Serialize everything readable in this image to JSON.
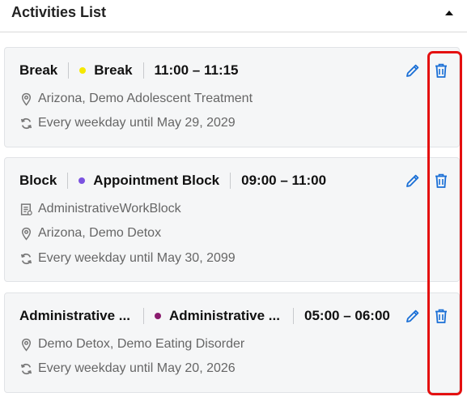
{
  "header": {
    "title": "Activities List",
    "collapse_icon": "caret-up-icon"
  },
  "activities": [
    {
      "type": "Break",
      "category": "Break",
      "category_color": "#f5e800",
      "time": "11:00 – 11:15",
      "location": "Arizona, Demo Adolescent Treatment",
      "recurrence": "Every weekday until May 29, 2029"
    },
    {
      "type": "Block",
      "category": "Appointment Block",
      "category_color": "#7b52e0",
      "time": "09:00 – 11:00",
      "work_block": "AdministrativeWorkBlock",
      "location": "Arizona, Demo Detox",
      "recurrence": "Every weekday until May 30, 2099"
    },
    {
      "type": "Administrative ...",
      "category": "Administrative ...",
      "category_color": "#8a1c6e",
      "time": "05:00 – 06:00",
      "location": "Demo Detox, Demo Eating Disorder",
      "recurrence": "Every weekday until May 20, 2026"
    }
  ],
  "icons": {
    "location": "map-pin-icon",
    "recurrence": "repeat-icon",
    "work_block": "document-icon",
    "edit": "pencil-icon",
    "delete": "trash-icon"
  },
  "colors": {
    "accent": "#1a6fd6",
    "highlight": "#e41010",
    "card_background": "#f5f6f7"
  }
}
